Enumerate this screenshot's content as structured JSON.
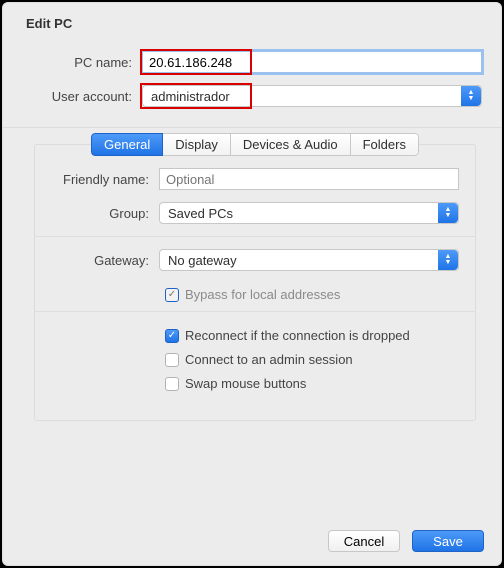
{
  "title": "Edit PC",
  "top": {
    "pc_name_label": "PC name:",
    "pc_name_value": "20.61.186.248",
    "user_account_label": "User account:",
    "user_account_value": "administrador"
  },
  "tabs": {
    "general": "General",
    "display": "Display",
    "devices": "Devices & Audio",
    "folders": "Folders"
  },
  "general": {
    "friendly_name_label": "Friendly name:",
    "friendly_name_placeholder": "Optional",
    "friendly_name_value": "",
    "group_label": "Group:",
    "group_value": "Saved PCs",
    "gateway_label": "Gateway:",
    "gateway_value": "No gateway",
    "bypass_label": "Bypass for local addresses",
    "reconnect_label": "Reconnect if the connection is dropped",
    "admin_session_label": "Connect to an admin session",
    "swap_mouse_label": "Swap mouse buttons"
  },
  "buttons": {
    "cancel": "Cancel",
    "save": "Save"
  }
}
